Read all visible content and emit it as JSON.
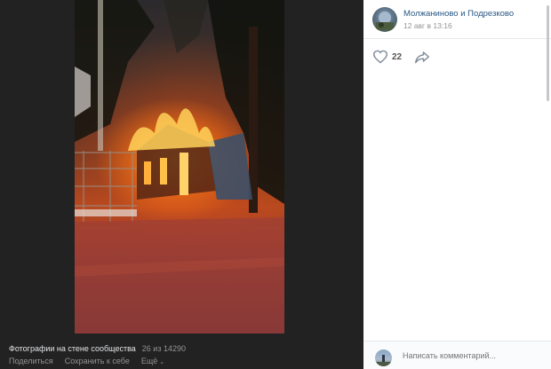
{
  "viewer": {
    "caption": "Фотографии на стене сообщества",
    "counter": "26 из 14290",
    "actions": {
      "share": "Поделиться",
      "save": "Сохранить к себе",
      "more": "Ещё",
      "more_icon": "⌄"
    }
  },
  "post": {
    "author": "Молжаниново и Подрезково",
    "date": "12 авг в 13:16",
    "likes": "22"
  },
  "comment": {
    "placeholder": "Написать комментарий..."
  },
  "colors": {
    "link": "#2a5885",
    "muted": "#939393",
    "viewer_bg": "#222222"
  },
  "icons": {
    "like": "heart-icon",
    "share": "share-arrow-icon"
  }
}
